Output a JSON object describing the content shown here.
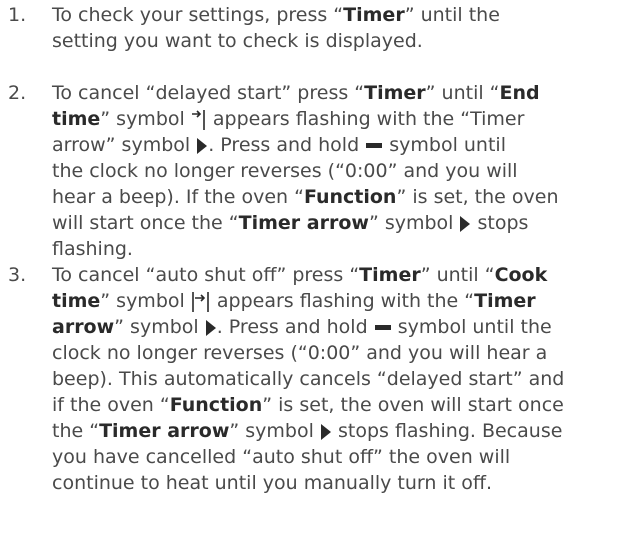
{
  "steps": [
    {
      "number": "1.",
      "lines": [
        [
          "To check your settings, press “",
          "Timer",
          "” until the"
        ],
        [
          "setting you want to check is displayed."
        ]
      ]
    },
    {
      "number": "2.",
      "lines": [
        [
          "To cancel “delayed start” press “",
          "Timer",
          "” until “",
          "End"
        ],
        [
          "time",
          "” symbol ",
          " appears flashing with the “Timer"
        ],
        [
          "arrow” symbol ",
          ". Press and hold ",
          " symbol until"
        ],
        [
          "the clock no longer reverses (“0:00” and you will"
        ],
        [
          "hear a beep). If the oven “",
          "Function",
          "” is set, the oven"
        ],
        [
          "will start once the “",
          "Timer arrow",
          "” symbol ",
          " stops"
        ],
        [
          "flashing."
        ]
      ]
    },
    {
      "number": "3.",
      "lines": [
        [
          "To cancel “auto shut off” press “",
          "Timer",
          "” until “",
          "Cook"
        ],
        [
          "time",
          "” symbol ",
          " appears flashing with the “",
          "Timer"
        ],
        [
          "arrow",
          "” symbol ",
          ". Press and hold ",
          "  symbol until the"
        ],
        [
          "clock no longer reverses (“0:00” and you will hear a"
        ],
        [
          "beep). This automatically cancels “delayed start” and"
        ],
        [
          "if the oven “",
          "Function",
          "” is set, the oven will start once"
        ],
        [
          "the “",
          "Timer arrow",
          "” symbol ",
          " stops flashing. Because"
        ],
        [
          "you have cancelled “auto shut off” the oven will"
        ],
        [
          "continue to heat until you manually turn it off."
        ]
      ]
    }
  ],
  "icons": {
    "end_time": "end-time-icon",
    "cook_time": "cook-time-icon",
    "timer_arrow": "timer-arrow-icon",
    "minus": "minus-icon"
  }
}
